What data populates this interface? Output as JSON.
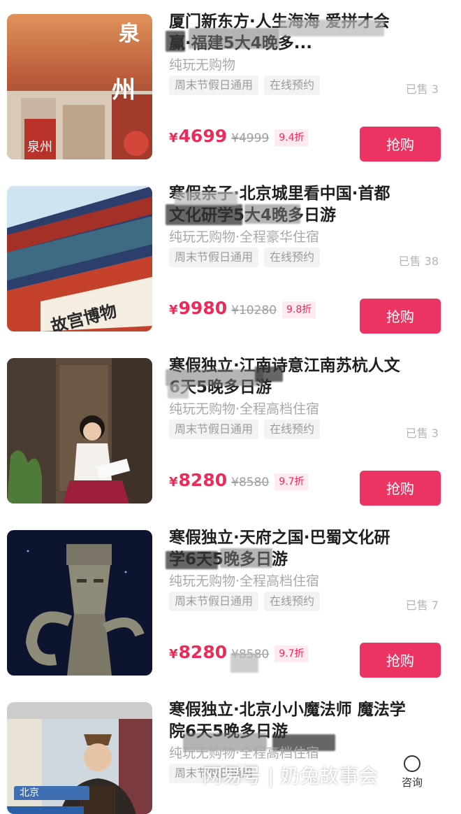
{
  "products": [
    {
      "title_line1": "厦门新东方·人生海海 爱拼才会",
      "title_line2": "赢·福建5大4晚多...",
      "subtitle": "纯玩无购物",
      "tags": [
        "周末节假日通用",
        "在线预约"
      ],
      "sold": "已售 3",
      "price": "4699",
      "orig_price": "¥4999",
      "discount": "9.4折",
      "image_text": "泉州",
      "image_icon": "quanzhou-city-photo"
    },
    {
      "title_line1": "寒假亲子·北京城里看中国·首都",
      "title_line2": "文化研学5大4晚多日游",
      "subtitle": "纯玩无购物·全程豪华住宿",
      "tags": [
        "周末节假日通用",
        "在线预约"
      ],
      "sold": "已售 38",
      "price": "9980",
      "orig_price": "¥10280",
      "discount": "9.8折",
      "image_text": "故宫博物",
      "image_icon": "palace-museum-gate-photo"
    },
    {
      "title_line1": "寒假独立·江南诗意江南苏杭人文",
      "title_line2": "6天5晚多日游",
      "subtitle": "纯玩无购物·全程高档住宿",
      "tags": [
        "周末节假日通用",
        "在线预约"
      ],
      "sold": "已售 3",
      "price": "8280",
      "orig_price": "¥8580",
      "discount": "9.7折",
      "image_icon": "girl-reading-photo"
    },
    {
      "title_line1": "寒假独立·天府之国·巴蜀文化研",
      "title_line2": "学6天5晚多日游",
      "subtitle": "纯玩无购物·全程高档住宿",
      "tags": [
        "周末节假日通用",
        "在线预约"
      ],
      "sold": "已售 7",
      "price": "8280",
      "orig_price": "¥8580",
      "discount": "9.7折",
      "image_icon": "sanxingdui-bronze-photo"
    },
    {
      "title_line1": "寒假独立·北京小小魔法师 魔法学",
      "title_line2": "院6天5晚多日游",
      "subtitle": "纯玩无购物·全程高档住宿",
      "tags": [
        "周末节假日通用"
      ],
      "image_icon": "magician-photo"
    }
  ],
  "buy_label": "抢购",
  "currency": "¥",
  "watermark": "网易号 | 奶兔故事会",
  "consult_label": "咨询",
  "bottom_badge": "北京",
  "colors": {
    "accent": "#eb3462",
    "price": "#ee2a5a",
    "tag_bg": "#f3f3f3"
  }
}
